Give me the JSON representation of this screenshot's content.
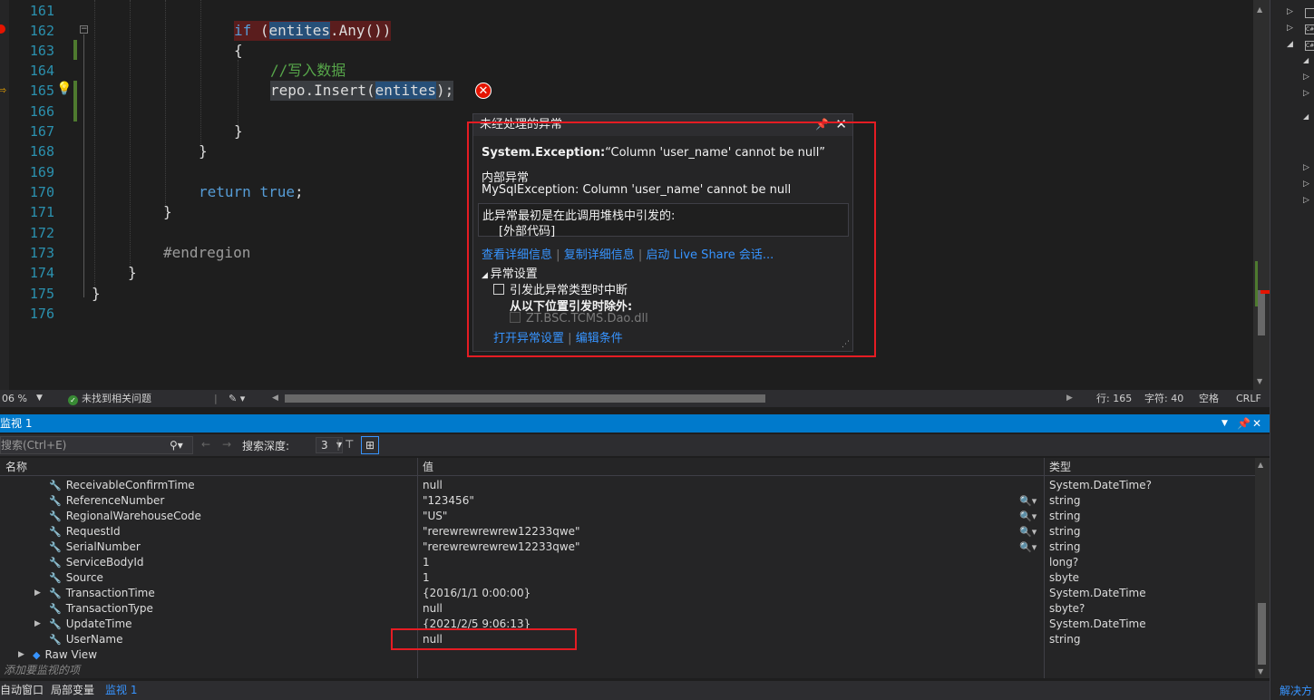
{
  "editor": {
    "lines": [
      {
        "num": "161"
      },
      {
        "num": "162",
        "if_kw": "if",
        "paren_open": " (",
        "var": "entites",
        "tail": ".Any())"
      },
      {
        "num": "163",
        "text": "{"
      },
      {
        "num": "164",
        "comment": "//写入数据"
      },
      {
        "num": "165",
        "head": "repo.Insert(",
        "var": "entites",
        "tail": ");"
      },
      {
        "num": "166"
      },
      {
        "num": "167",
        "text": "}"
      },
      {
        "num": "168",
        "text": "}"
      },
      {
        "num": "169"
      },
      {
        "num": "170",
        "kw": "return",
        "kw2": "true",
        "tail": ";"
      },
      {
        "num": "171",
        "text": "}"
      },
      {
        "num": "172"
      },
      {
        "num": "173",
        "pp": "#endregion"
      },
      {
        "num": "174",
        "text": "}"
      },
      {
        "num": "175",
        "text": "}"
      },
      {
        "num": "176"
      }
    ]
  },
  "exception": {
    "title": "未经处理的异常",
    "type": "System.Exception:",
    "message": "“Column 'user_name' cannot be null”",
    "inner_heading": "内部异常",
    "inner_message": "MySqlException: Column 'user_name' cannot be null",
    "stack_heading": "此异常最初是在此调用堆栈中引发的:",
    "stack_frame": "[外部代码]",
    "link_details": "查看详细信息",
    "link_copy": "复制详细信息",
    "link_liveshare": "启动 Live Share 会话...",
    "settings_heading": "异常设置",
    "settings_break": "引发此异常类型时中断",
    "settings_except": "从以下位置引发时除外:",
    "settings_module": "ZT.BSC.TCMS.Dao.dll",
    "link_open_settings": "打开异常设置",
    "link_edit_conditions": "编辑条件"
  },
  "status": {
    "zoom": "06 %",
    "issues": "未找到相关问题",
    "line": "行: 165",
    "char": "字符: 40",
    "space": "空格",
    "eol": "CRLF"
  },
  "watch": {
    "title": "监视 1",
    "search_placeholder": "搜索(Ctrl+E)",
    "depth_label": "搜索深度:",
    "depth_value": "3",
    "headers": {
      "name": "名称",
      "value": "值",
      "type": "类型"
    },
    "rows": [
      {
        "name": "ReceivableConfirmTime",
        "value": "null",
        "type": "System.DateTime?"
      },
      {
        "name": "ReferenceNumber",
        "value": "\"123456\"",
        "type": "string"
      },
      {
        "name": "RegionalWarehouseCode",
        "value": "\"US\"",
        "type": "string"
      },
      {
        "name": "RequestId",
        "value": "\"rerewrewrewrew12233qwe\"",
        "type": "string"
      },
      {
        "name": "SerialNumber",
        "value": "\"rerewrewrewrew12233qwe\"",
        "type": "string"
      },
      {
        "name": "ServiceBodyId",
        "value": "1",
        "type": "long?"
      },
      {
        "name": "Source",
        "value": "1",
        "type": "sbyte"
      },
      {
        "name": "TransactionTime",
        "value": "{2016/1/1 0:00:00}",
        "type": "System.DateTime"
      },
      {
        "name": "TransactionType",
        "value": "null",
        "type": "sbyte?"
      },
      {
        "name": "UpdateTime",
        "value": "{2021/2/5 9:06:13}",
        "type": "System.DateTime"
      },
      {
        "name": "UserName",
        "value": "null",
        "type": "string"
      },
      {
        "name": "Raw View",
        "value": "",
        "type": ""
      }
    ],
    "add_placeholder": "添加要监视的项"
  },
  "bottom_tabs": [
    "自动窗口",
    "局部变量",
    "监视 1"
  ],
  "right_panel": {
    "bottom_label": "解决方"
  },
  "colors": {
    "accent": "#007acc",
    "error": "#e51400",
    "highlight_box": "#e51c23"
  }
}
